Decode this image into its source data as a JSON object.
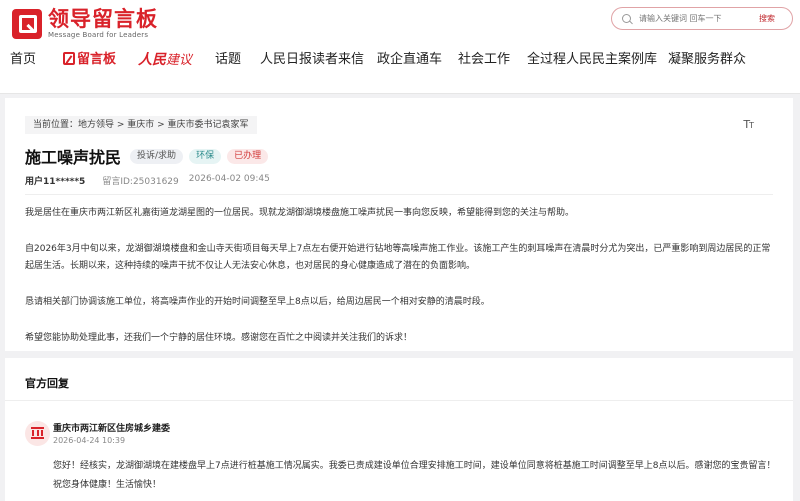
{
  "header": {
    "logo_title": "领导留言板",
    "logo_sub": "Message Board for Leaders",
    "search_placeholder": "请输入关键词 回车一下",
    "search_button": "搜索"
  },
  "nav": {
    "items": [
      "首页",
      "留言板",
      "建议",
      "话题",
      "人民日报读者来信",
      "政企直通车",
      "社会工作",
      "全过程人民民主案例库",
      "凝聚服务群众"
    ],
    "brand_prefix": "人民"
  },
  "post": {
    "breadcrumb": "当前位置：地方领导 > 重庆市 > 重庆市委书记袁家军",
    "title": "施工噪声扰民",
    "tags": [
      "投诉/求助",
      "环保",
      "已办理"
    ],
    "user": "用户11*****5",
    "message_id": "留言ID:25031629",
    "time": "2026-04-02 09:45",
    "paragraphs": [
      "我是居住在重庆市两江新区礼嘉街道龙湖星图的一位居民。现就龙湖御湖境楼盘施工噪声扰民一事向您反映，希望能得到您的关注与帮助。",
      "自2026年3月中旬以来，龙湖御湖境楼盘和金山寺天街项目每天早上7点左右便开始进行钻地等高噪声施工作业。该施工产生的刺耳噪声在清晨时分尤为突出，已严重影响到周边居民的正常起居生活。长期以来，这种持续的噪声干扰不仅让人无法安心休息，也对居民的身心健康造成了潜在的负面影响。",
      "恳请相关部门协调该施工单位，将高噪声作业的开始时间调整至早上8点以后，给周边居民一个相对安静的清晨时段。",
      "希望您能协助处理此事，还我们一个宁静的居住环境。感谢您在百忙之中阅读并关注我们的诉求！"
    ]
  },
  "reply": {
    "heading": "官方回复",
    "org": "重庆市两江新区住房城乡建委",
    "time": "2026-04-24 10:39",
    "text": "您好！经核实，龙湖御湖境在建楼盘早上7点进行桩基施工情况属实。我委已责成建设单位合理安排施工时间，建设单位同意将桩基施工时间调整至早上8点以后。感谢您的宝贵留言！祝您身体健康！生活愉快！"
  },
  "colors": {
    "accent": "#d9222a",
    "teal": "#2b8a8a"
  },
  "icons": [
    "logo-icon",
    "search-icon",
    "edit-icon",
    "font-size-icon",
    "government-building-icon"
  ]
}
